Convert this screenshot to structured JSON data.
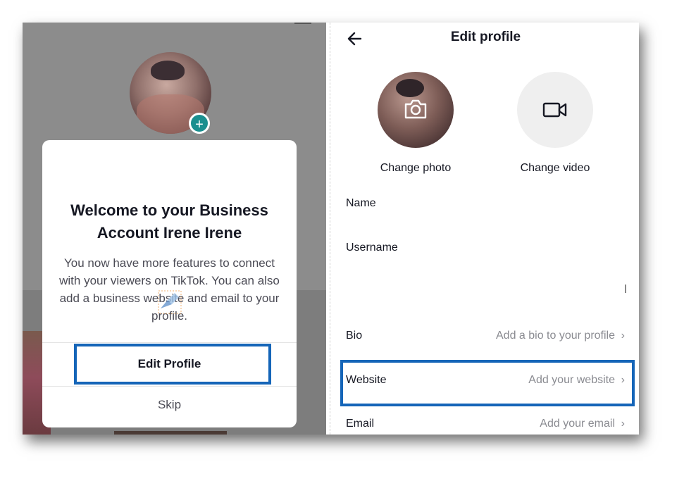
{
  "left_screen": {
    "dialog": {
      "title": "Welcome to your Business Account Irene Irene",
      "body": "You now have more features to connect with your viewers on TikTok. You can also add a business website and email to your profile.",
      "primary_button": "Edit Profile",
      "secondary_button": "Skip"
    },
    "plus_badge": "+",
    "accent_color": "#1b8f8f"
  },
  "right_screen": {
    "header": {
      "title": "Edit profile",
      "back_icon": "back-arrow-icon"
    },
    "photo": {
      "label": "Change photo",
      "icon": "camera-icon"
    },
    "video": {
      "label": "Change video",
      "icon": "video-camera-icon"
    },
    "fields": {
      "name": {
        "label": "Name"
      },
      "username": {
        "label": "Username"
      },
      "bio": {
        "label": "Bio",
        "placeholder": "Add a bio to your profile"
      },
      "website": {
        "label": "Website",
        "placeholder": "Add your website"
      },
      "email": {
        "label": "Email",
        "placeholder": "Add your email"
      }
    },
    "chevron": "›"
  },
  "highlight_color": "#1565b8"
}
